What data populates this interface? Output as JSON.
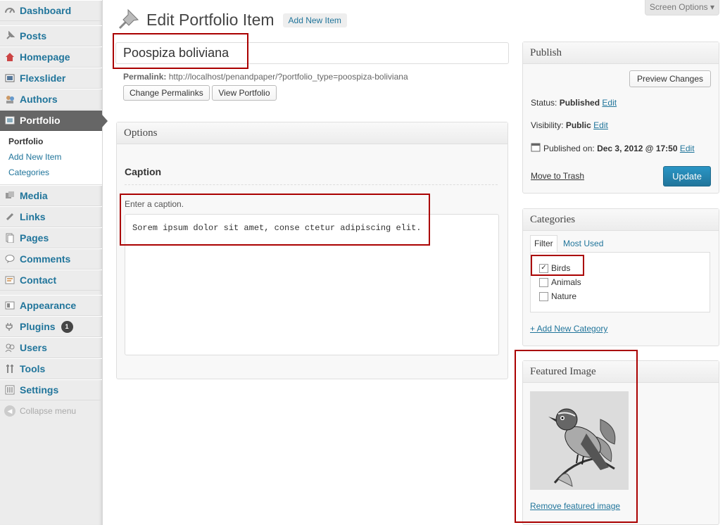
{
  "sidebar": {
    "items": [
      {
        "label": "Dashboard",
        "icon": "dashboard-icon"
      },
      {
        "label": "Posts",
        "icon": "pushpin-icon"
      },
      {
        "label": "Homepage",
        "icon": "home-icon"
      },
      {
        "label": "Flexslider",
        "icon": "slider-icon"
      },
      {
        "label": "Authors",
        "icon": "authors-icon"
      },
      {
        "label": "Portfolio",
        "icon": "portfolio-icon"
      },
      {
        "label": "Media",
        "icon": "media-icon"
      },
      {
        "label": "Links",
        "icon": "links-icon"
      },
      {
        "label": "Pages",
        "icon": "pages-icon"
      },
      {
        "label": "Comments",
        "icon": "comments-icon"
      },
      {
        "label": "Contact",
        "icon": "contact-icon"
      },
      {
        "label": "Appearance",
        "icon": "appearance-icon"
      },
      {
        "label": "Plugins",
        "icon": "plugins-icon",
        "badge": "1"
      },
      {
        "label": "Users",
        "icon": "users-icon"
      },
      {
        "label": "Tools",
        "icon": "tools-icon"
      },
      {
        "label": "Settings",
        "icon": "settings-icon"
      }
    ],
    "portfolio_sub": [
      "Portfolio",
      "Add New Item",
      "Categories"
    ],
    "collapse": "Collapse menu"
  },
  "header": {
    "title": "Edit Portfolio Item",
    "add_new": "Add New Item",
    "screen_options": "Screen Options"
  },
  "post": {
    "title": "Poospiza boliviana",
    "permalink_label": "Permalink:",
    "permalink_url": "http://localhost/penandpaper/?portfolio_type=poospiza-boliviana",
    "change_permalinks": "Change Permalinks",
    "view_portfolio": "View Portfolio"
  },
  "options": {
    "heading": "Options",
    "caption_heading": "Caption",
    "caption_label": "Enter a caption.",
    "caption_value": "Sorem ipsum dolor sit amet, conse ctetur adipiscing elit."
  },
  "publish": {
    "heading": "Publish",
    "preview": "Preview Changes",
    "status_label": "Status:",
    "status_value": "Published",
    "visibility_label": "Visibility:",
    "visibility_value": "Public",
    "published_label": "Published on:",
    "published_value": "Dec 3, 2012 @ 17:50",
    "edit": "Edit",
    "trash": "Move to Trash",
    "update": "Update"
  },
  "categories": {
    "heading": "Categories",
    "tab_filter": "Filter",
    "tab_most_used": "Most Used",
    "items": [
      {
        "label": "Birds",
        "checked": true
      },
      {
        "label": "Animals",
        "checked": false
      },
      {
        "label": "Nature",
        "checked": false
      }
    ],
    "add_new": "+ Add New Category"
  },
  "featured": {
    "heading": "Featured Image",
    "remove": "Remove featured image"
  },
  "colors": {
    "accent": "#21759b",
    "highlight": "#aa0000",
    "update_button": "#21759b"
  }
}
